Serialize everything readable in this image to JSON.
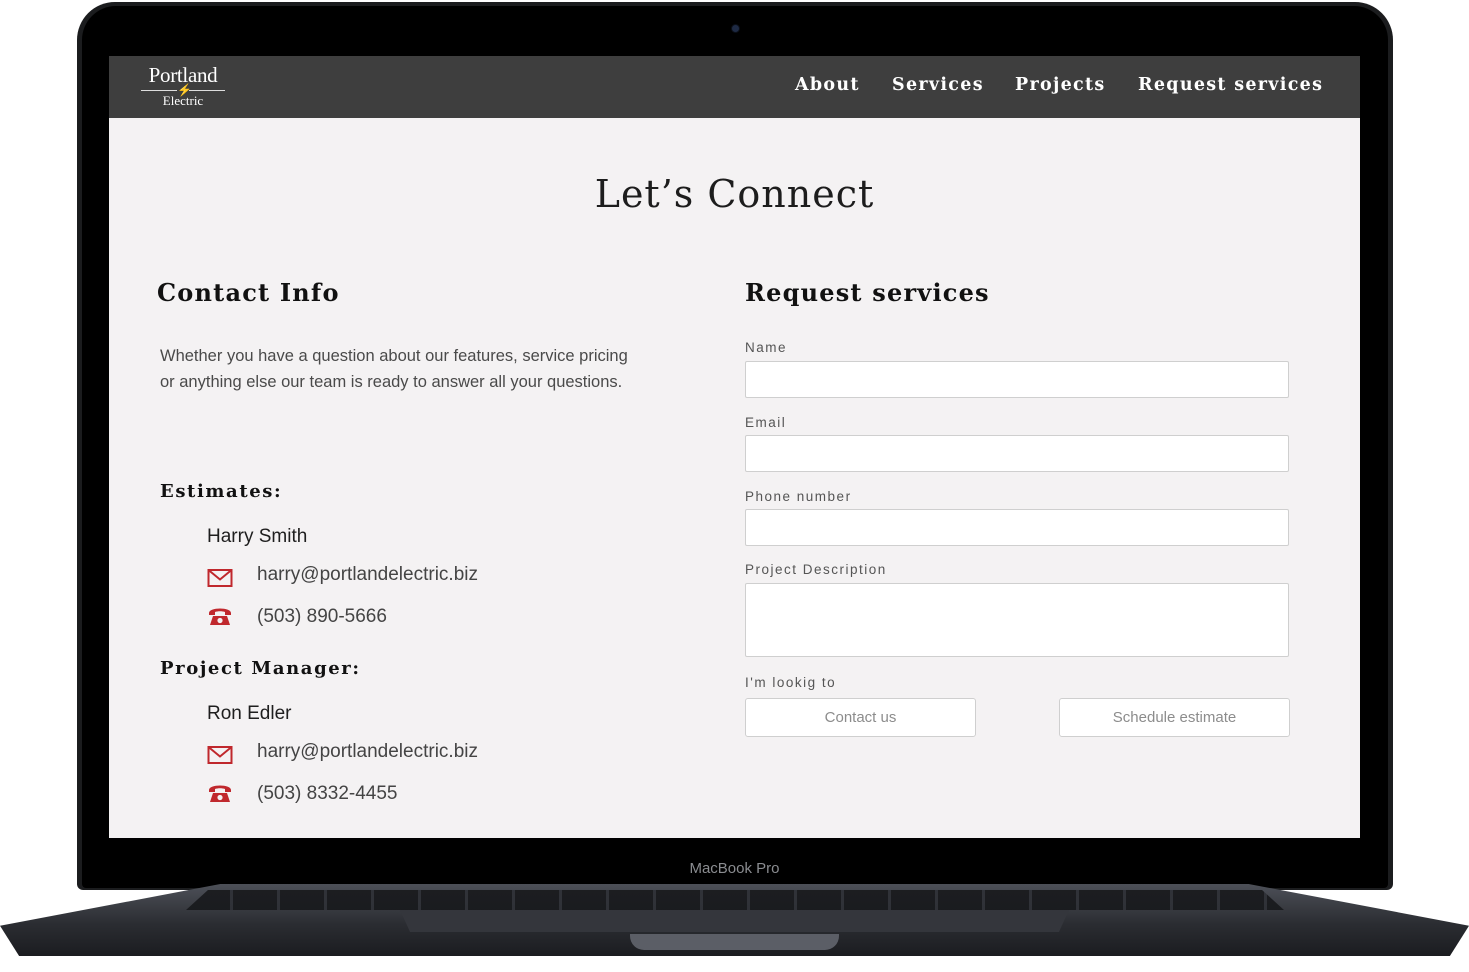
{
  "device": {
    "model_label": "MacBook Pro"
  },
  "brand": {
    "name": "Portland",
    "sub": "Electric",
    "bolt_symbol": "⚡"
  },
  "nav": [
    "About",
    "Services",
    "Projects",
    "Request services"
  ],
  "page_title": "Let’s Connect",
  "contact": {
    "heading": "Contact Info",
    "intro": "Whether you have a question about our features, service pricing or anything else our team is ready to answer all your questions.",
    "groups": [
      {
        "title": "Estimates:",
        "name": "Harry Smith",
        "email": "harry@portlandelectric.biz",
        "phone": "(503) 890-5666"
      },
      {
        "title": "Project Manager:",
        "name": "Ron Edler",
        "email": "harry@portlandelectric.biz",
        "phone": "(503) 8332-4455"
      }
    ]
  },
  "form": {
    "heading": "Request services",
    "name_label": "Name",
    "email_label": "Email",
    "phone_label": "Phone number",
    "description_label": "Project Description",
    "choice_label": "I'm lookig to",
    "options": [
      "Contact us",
      "Schedule estimate"
    ]
  },
  "colors": {
    "nav_bg": "#3e3e3e",
    "page_bg": "#f4f2f3",
    "icon_red": "#c0282d"
  }
}
